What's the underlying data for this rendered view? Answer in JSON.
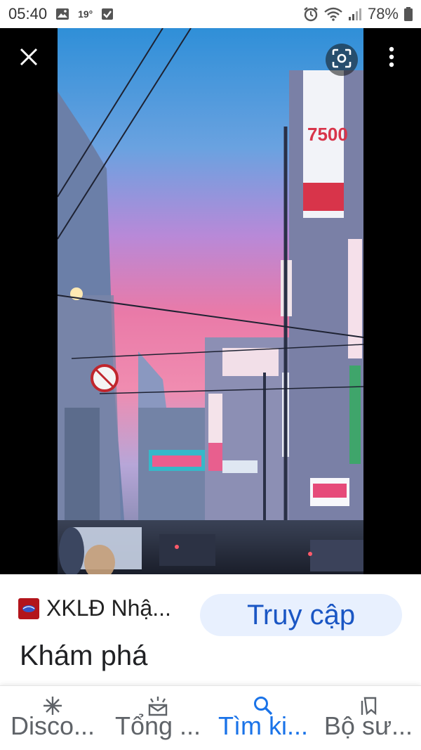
{
  "status_bar": {
    "time": "05:40",
    "temperature": "19°",
    "battery_percent": "78%",
    "icons": [
      "gallery-icon",
      "check-box-icon",
      "alarm-icon",
      "wifi-icon",
      "signal-icon",
      "battery-icon"
    ]
  },
  "viewer": {
    "close_icon": "close-icon",
    "lens_icon": "lens-icon",
    "more_icon": "more-vert-icon",
    "background_color": "#000000"
  },
  "source": {
    "site_name": "XKLĐ Nhậ...",
    "visit_label": "Truy cập",
    "image_title": "Khám phá",
    "favicon_color": "#b3151c",
    "visit_bg": "#e8f0fe",
    "visit_text_color": "#1a56c4"
  },
  "bottom_nav": {
    "items": [
      {
        "label": "Disco...",
        "icon": "discover-icon",
        "active": false
      },
      {
        "label": "Tổng ...",
        "icon": "updates-icon",
        "active": false
      },
      {
        "label": "Tìm ki...",
        "icon": "search-icon",
        "active": true
      },
      {
        "label": "Bộ sư...",
        "icon": "collections-icon",
        "active": false
      }
    ],
    "active_color": "#1a73e8",
    "inactive_color": "#5f6368"
  }
}
